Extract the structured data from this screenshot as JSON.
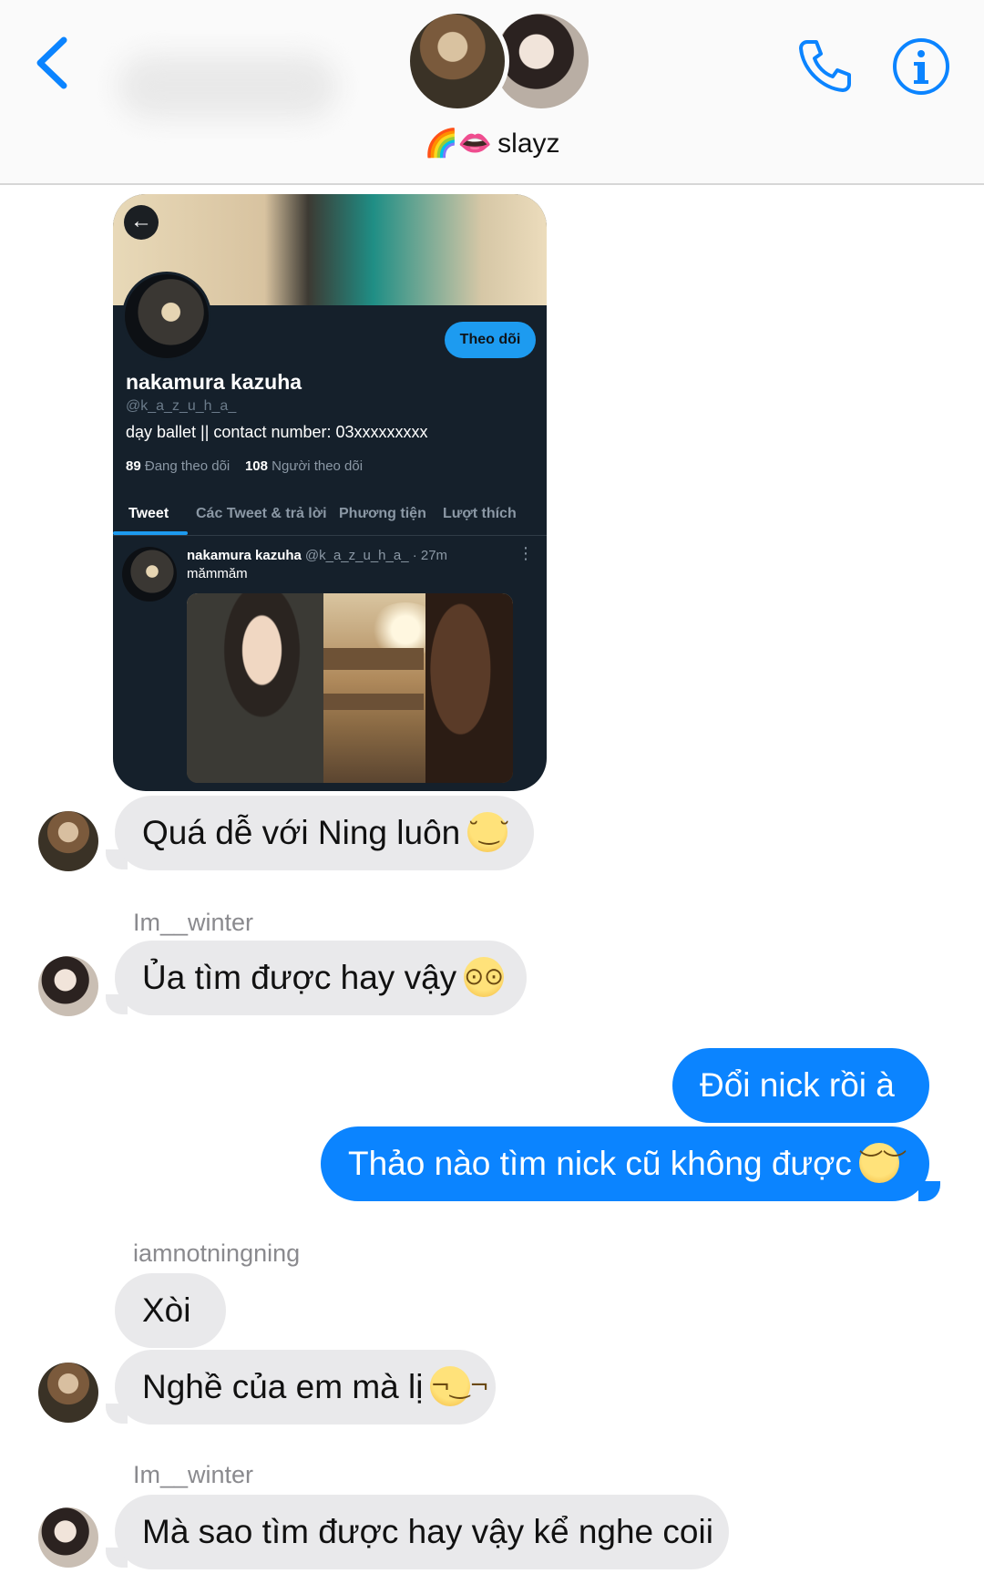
{
  "header": {
    "group_name": "slayz",
    "group_name_prefix": "🌈👄",
    "back_icon": "chevron-left-icon",
    "call_icon": "phone-icon",
    "info_icon": "info-icon",
    "accent_color": "#0b84ff"
  },
  "twitter_card": {
    "follow_label": "Theo dõi",
    "name": "nakamura kazuha",
    "handle": "@k_a_z_u_h_a_",
    "bio": "dạy ballet || contact number: 03xxxxxxxxx",
    "following_count": "89",
    "following_label": "Đang theo dõi",
    "followers_count": "108",
    "followers_label": "Người theo dõi",
    "tabs": [
      "Tweet",
      "Các Tweet & trả lời",
      "Phương tiện",
      "Lượt thích"
    ],
    "tweet": {
      "author": "nakamura kazuha",
      "meta": "@k_a_z_u_h_a_ · 27m",
      "text": "mămmăm"
    }
  },
  "messages": [
    {
      "sender": "",
      "text": "Quá dễ với Ning luôn",
      "emoji": "😌",
      "direction": "in"
    },
    {
      "sender": "Im__winter",
      "text": "Ủa tìm được hay vậy",
      "emoji": "😳",
      "direction": "in"
    },
    {
      "sender": "",
      "text": "Đổi nick rồi à",
      "direction": "out"
    },
    {
      "sender": "",
      "text": "Thảo nào tìm nick cũ không được",
      "emoji": "😔",
      "direction": "out"
    },
    {
      "sender": "iamnotningning",
      "text": "Xòi",
      "direction": "in"
    },
    {
      "sender": "",
      "text": "Nghề của em mà lị",
      "emoji": "😏",
      "direction": "in"
    },
    {
      "sender": "Im__winter",
      "text": "Mà sao tìm được hay vậy kể nghe coii",
      "direction": "in"
    }
  ]
}
